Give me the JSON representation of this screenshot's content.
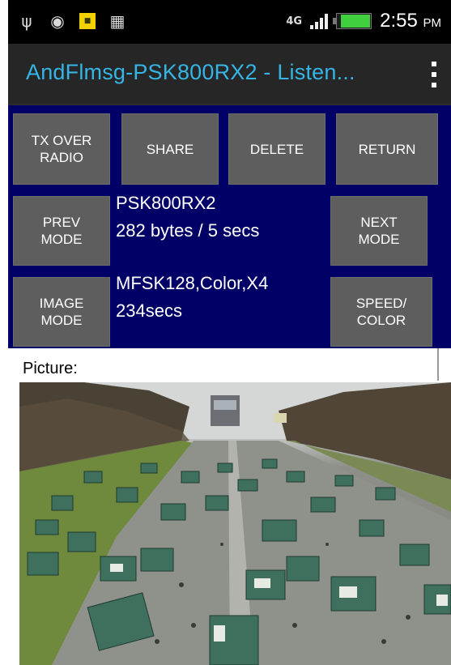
{
  "status_bar": {
    "icons": [
      "usb-icon",
      "android-debug-icon",
      "notification-icon",
      "calendar-icon"
    ],
    "network": "4G",
    "time": "2:55",
    "ampm": "PM"
  },
  "action_bar": {
    "title": "AndFlmsg-PSK800RX2 - Listen...",
    "title_color": "#35b5e5"
  },
  "buttons": {
    "tx_over_radio": "TX OVER\nRADIO",
    "share": "SHARE",
    "delete": "DELETE",
    "return": "RETURN",
    "prev_mode": "PREV\nMODE",
    "next_mode": "NEXT\nMODE",
    "image_mode": "IMAGE\nMODE",
    "speed_color": "SPEED/\nCOLOR"
  },
  "mode_info": {
    "mode": "PSK800RX2",
    "throughput": "282 bytes / 5 secs"
  },
  "image_info": {
    "settings": "MFSK128,Color,X4",
    "duration": "234secs"
  },
  "picture": {
    "label": "Picture:"
  },
  "colors": {
    "panel_bg": "#000066",
    "button_bg": "#5e5e5e",
    "actionbar_bg": "#262626"
  }
}
